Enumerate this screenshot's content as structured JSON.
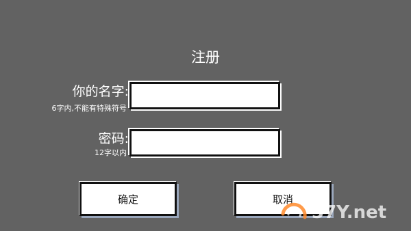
{
  "title": "注册",
  "name_field": {
    "label": "你的名字:",
    "hint": "6字内,不能有特殊符号",
    "value": ""
  },
  "password_field": {
    "label": "密码:",
    "hint": "12字以内",
    "value": ""
  },
  "buttons": {
    "confirm": "确定",
    "cancel": "取消"
  },
  "watermark": {
    "text": "37Y.net",
    "icon": "swirl-logo-icon"
  },
  "colors": {
    "background": "#626262",
    "field_fill": "#ffffff",
    "border": "#111111",
    "button_shadow": "#9aa7bc",
    "watermark_orange": "#ff8a2a"
  }
}
